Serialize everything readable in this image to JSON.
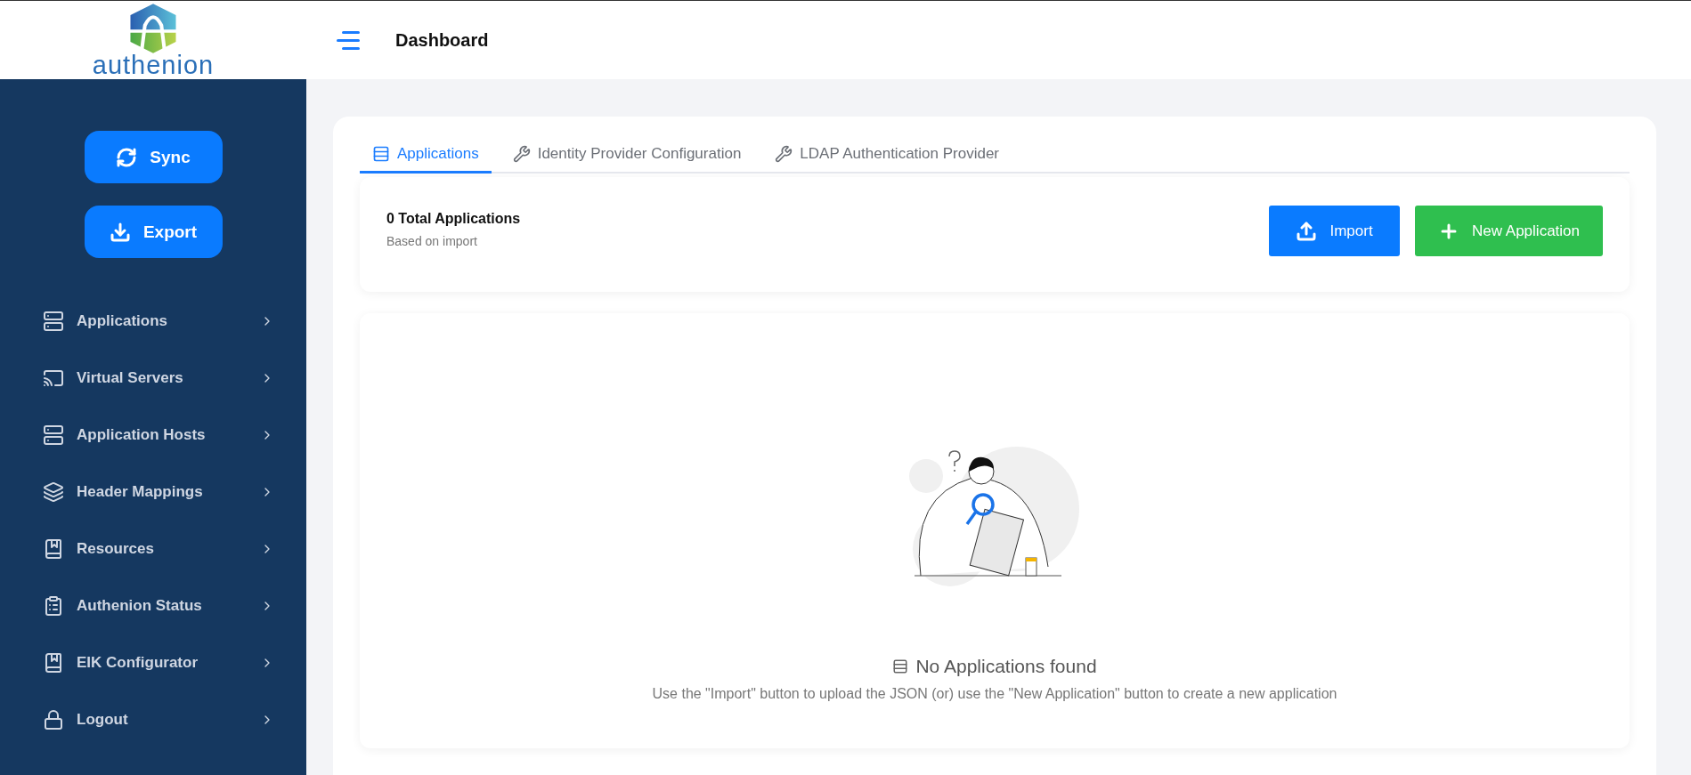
{
  "brand": {
    "name": "authenion"
  },
  "header": {
    "title": "Dashboard"
  },
  "sidebar": {
    "actions": [
      {
        "label": "Sync"
      },
      {
        "label": "Export"
      }
    ],
    "items": [
      {
        "label": "Applications"
      },
      {
        "label": "Virtual Servers"
      },
      {
        "label": "Application Hosts"
      },
      {
        "label": "Header Mappings"
      },
      {
        "label": "Resources"
      },
      {
        "label": "Authenion Status"
      },
      {
        "label": "EIK Configurator"
      },
      {
        "label": "Logout"
      }
    ]
  },
  "tabs": [
    {
      "label": "Applications",
      "selected": true
    },
    {
      "label": "Identity Provider Configuration",
      "selected": false
    },
    {
      "label": "LDAP Authentication Provider",
      "selected": false
    }
  ],
  "summary": {
    "title": "0 Total Applications",
    "subtitle": "Based on import"
  },
  "buttons": [
    {
      "label": "Import",
      "kind": "primary"
    },
    {
      "label": "New Application",
      "kind": "success"
    }
  ],
  "empty_state": {
    "title": "No Applications found",
    "message": "Use the \"Import\" button to upload the JSON (or) use the \"New Application\" button to create a new application"
  }
}
